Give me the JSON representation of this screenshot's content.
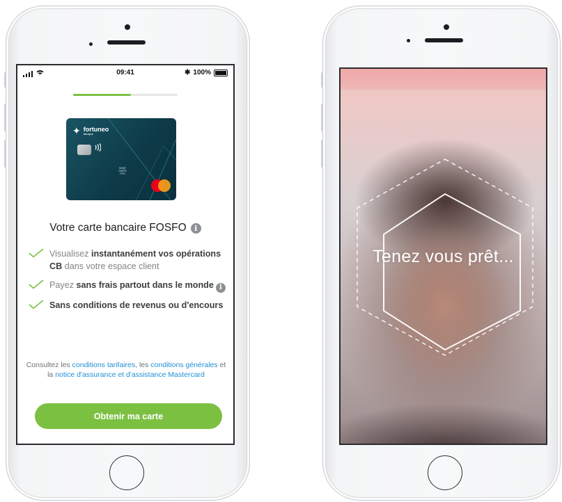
{
  "status_bar": {
    "time": "09:41",
    "battery": "100%",
    "bluetooth_symbol": "✱"
  },
  "signup": {
    "progress_fraction": 0.55,
    "card": {
      "brand": "fortuneo",
      "brand_sub": "banque",
      "debit_label": "DEBIT\nCARTE\nFOS"
    },
    "title": "Votre carte bancaire FOSFO",
    "features": [
      {
        "pre": "Visualisez ",
        "bold": "instantanément vos opérations CB",
        "post": " dans votre espace client",
        "info": false
      },
      {
        "pre": "Payez ",
        "bold": "sans frais partout dans le monde",
        "post": "",
        "info": true
      },
      {
        "pre": "",
        "bold": "Sans conditions de revenus ou d'encours",
        "post": "",
        "info": false
      }
    ],
    "terms": {
      "t1": "Consultez les ",
      "link1": "conditions tarifaires",
      "t2": ", les ",
      "link2": "conditions générales",
      "t3": " et la ",
      "link3": "notice d'assurance et d'assistance Mastercard"
    },
    "cta_label": "Obtenir ma carte"
  },
  "face_scan": {
    "message": "Tenez vous prêt..."
  },
  "colors": {
    "accent_green": "#7cc042",
    "link_blue": "#1f8fd6",
    "card_teal": "#0e3b49"
  }
}
